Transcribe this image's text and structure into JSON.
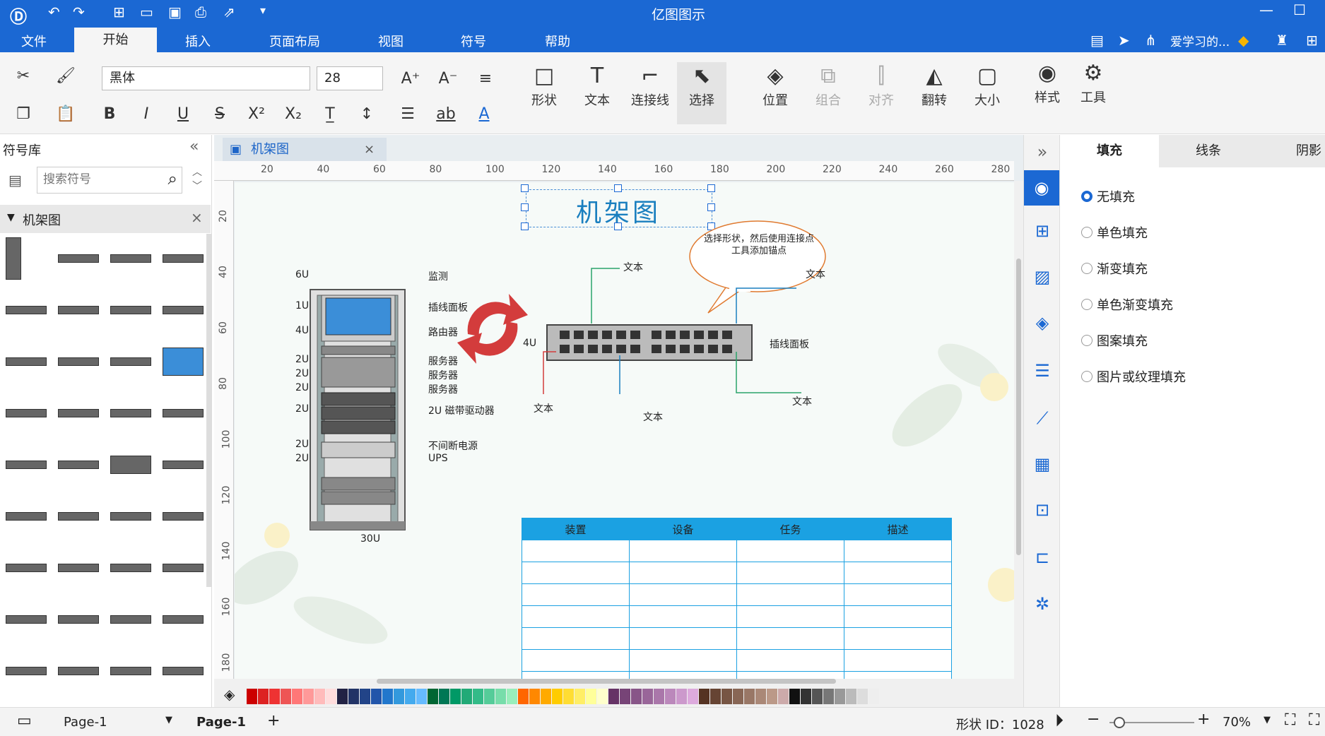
{
  "app": {
    "title": "亿图图示",
    "window": {
      "minimize": "—",
      "maximize": "☐"
    }
  },
  "menu": {
    "file": "文件",
    "home": "开始",
    "insert": "插入",
    "layout": "页面布局",
    "view": "视图",
    "symbol": "符号",
    "help": "帮助",
    "user": "爱学习的..."
  },
  "ribbon": {
    "font": "黑体",
    "font_size": "28",
    "shape": "形状",
    "text": "文本",
    "connector": "连接线",
    "select": "选择",
    "position": "位置",
    "group": "组合",
    "align": "对齐",
    "flip": "翻转",
    "size": "大小",
    "style": "样式",
    "tools": "工具"
  },
  "library": {
    "title": "符号库",
    "search_placeholder": "搜索符号",
    "category": "机架图"
  },
  "doc": {
    "tab": "机架图"
  },
  "ruler": {
    "h": [
      "20",
      "40",
      "60",
      "80",
      "100",
      "120",
      "140",
      "160",
      "180",
      "200",
      "220",
      "240",
      "260",
      "280"
    ],
    "v": [
      "20",
      "40",
      "60",
      "80",
      "100",
      "120",
      "140",
      "160",
      "180"
    ]
  },
  "diagram": {
    "title": "机架图",
    "callout": "选择形状，然后使用连接点工具添加锚点",
    "rack_units": [
      "6U",
      "1U",
      "4U",
      "2U",
      "2U",
      "2U",
      "2U",
      "2U",
      "2U"
    ],
    "rack_labels": [
      "监测",
      "插线面板",
      "路由器",
      "服务器",
      "服务器",
      "服务器",
      "2U 磁带驱动器",
      "不间断电源",
      "UPS"
    ],
    "rack_total": "30U",
    "panel_unit": "4U",
    "panel_label": "插线面板",
    "text_label": "文本",
    "table_headers": [
      "装置",
      "设备",
      "任务",
      "描述"
    ]
  },
  "props": {
    "tabs": [
      "填充",
      "线条",
      "阴影"
    ],
    "options": [
      "无填充",
      "单色填充",
      "渐变填充",
      "单色渐变填充",
      "图案填充",
      "图片或纹理填充"
    ]
  },
  "status": {
    "page_select": "Page-1",
    "page_tab": "Page-1",
    "shape_id": "形状 ID：1028",
    "zoom": "70%"
  }
}
